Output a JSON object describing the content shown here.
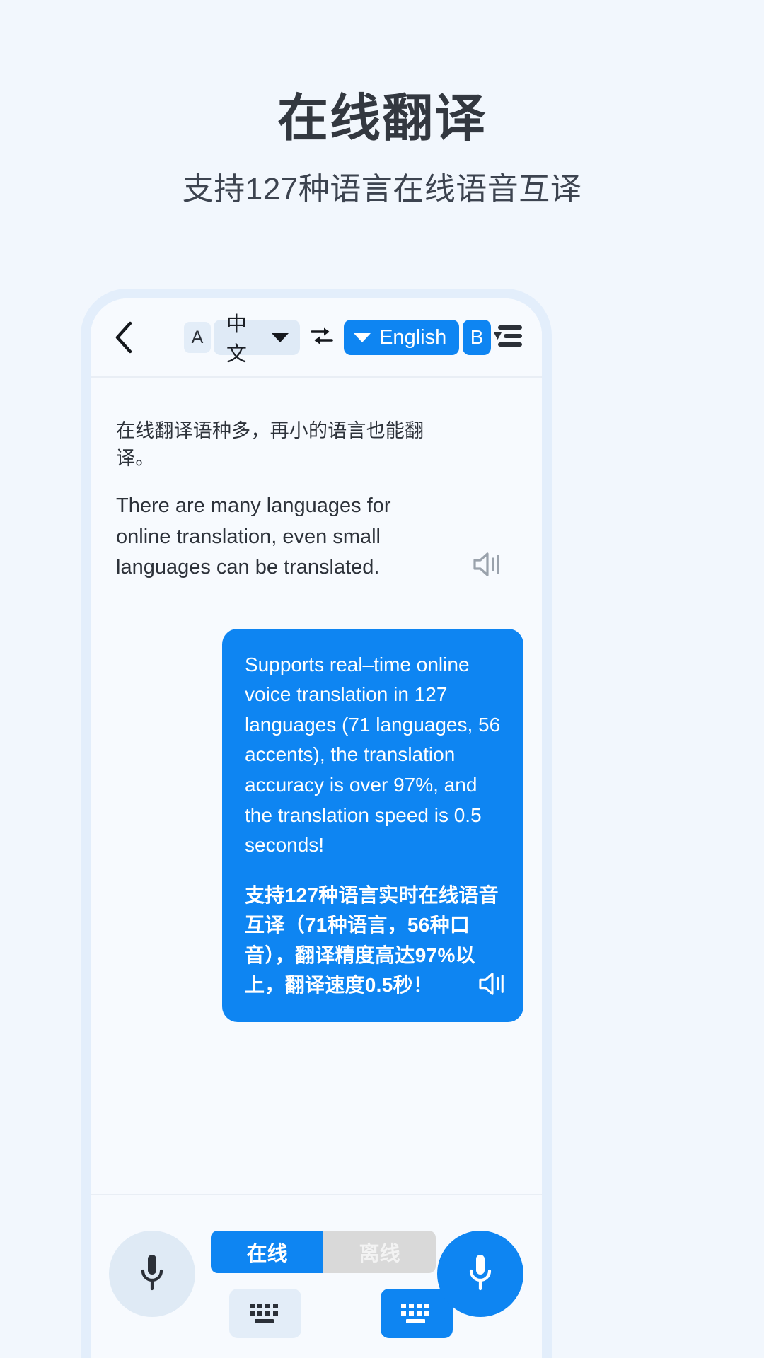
{
  "headline": {
    "title": "在线翻译",
    "subtitle": "支持127种语言在线语音互译"
  },
  "toolbar": {
    "back_icon": "chevron-left-icon",
    "source_badge": "A",
    "source_language": "中文",
    "source_chevron_icon": "triangle-down-icon",
    "swap_icon": "swap-arrows-icon",
    "target_chevron_icon": "triangle-down-icon",
    "target_language": "English",
    "target_badge": "B",
    "menu_icon": "list-menu-icon"
  },
  "conversation": {
    "incoming": {
      "chinese": "在线翻译语种多，再小的语言也能翻译。",
      "english": "There are many languages for online translation, even small languages can be translated.",
      "speaker_icon": "speaker-mute-icon"
    },
    "outgoing": {
      "english": "Supports real–time online voice translation in 127 languages (71 languages, 56 accents), the translation accuracy is over 97%, and the translation speed is 0.5 seconds!",
      "chinese": "支持127种语言实时在线语音互译（71种语言，56种口音），翻译精度高达97%以上，翻译速度0.5秒！",
      "speaker_icon": "speaker-mute-icon",
      "bubble_color": "#0e85f2"
    }
  },
  "bottom_bar": {
    "left_mic_icon": "microphone-icon",
    "right_mic_icon": "microphone-icon",
    "mode_online": "在线",
    "mode_offline": "离线",
    "left_keyboard_icon": "keyboard-icon",
    "right_keyboard_icon": "keyboard-icon"
  },
  "colors": {
    "page_background": "#f2f7fd",
    "accent_blue": "#0e85f2",
    "frame_border": "#e3eefb",
    "title_text": "#333840"
  }
}
